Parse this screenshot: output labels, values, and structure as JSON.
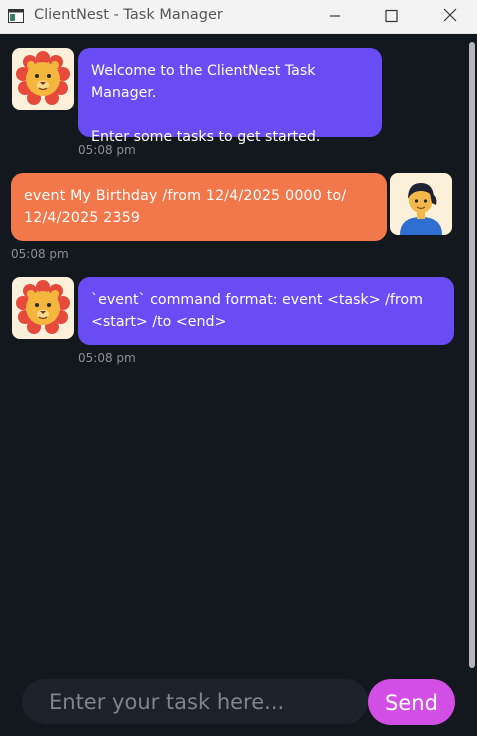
{
  "window": {
    "title": "ClientNest - Task Manager"
  },
  "messages": [
    {
      "sender": "bot",
      "avatar": "lion-avatar",
      "lines": [
        "Welcome to the ClientNest Task Manager.",
        "",
        "Enter some tasks to get started."
      ],
      "time": "05:08 pm"
    },
    {
      "sender": "user",
      "avatar": "user-avatar",
      "lines": [
        "event  My  Birthday /from  12/4/2025  0000  to/",
        "12/4/2025  2359"
      ],
      "time": "05:08 pm"
    },
    {
      "sender": "bot",
      "avatar": "lion-avatar",
      "lines": [
        "`event` command format: event <task> /from",
        "<start> /to <end>"
      ],
      "time": "05:08 pm"
    }
  ],
  "input": {
    "placeholder": "Enter your task here...",
    "value": ""
  },
  "send_button": {
    "label": "Send"
  },
  "colors": {
    "background": "#13171e",
    "bot_bubble": "#6a4cf4",
    "user_bubble": "#f2784b",
    "send_button": "#d24fe6",
    "input_background": "#1b222c"
  }
}
